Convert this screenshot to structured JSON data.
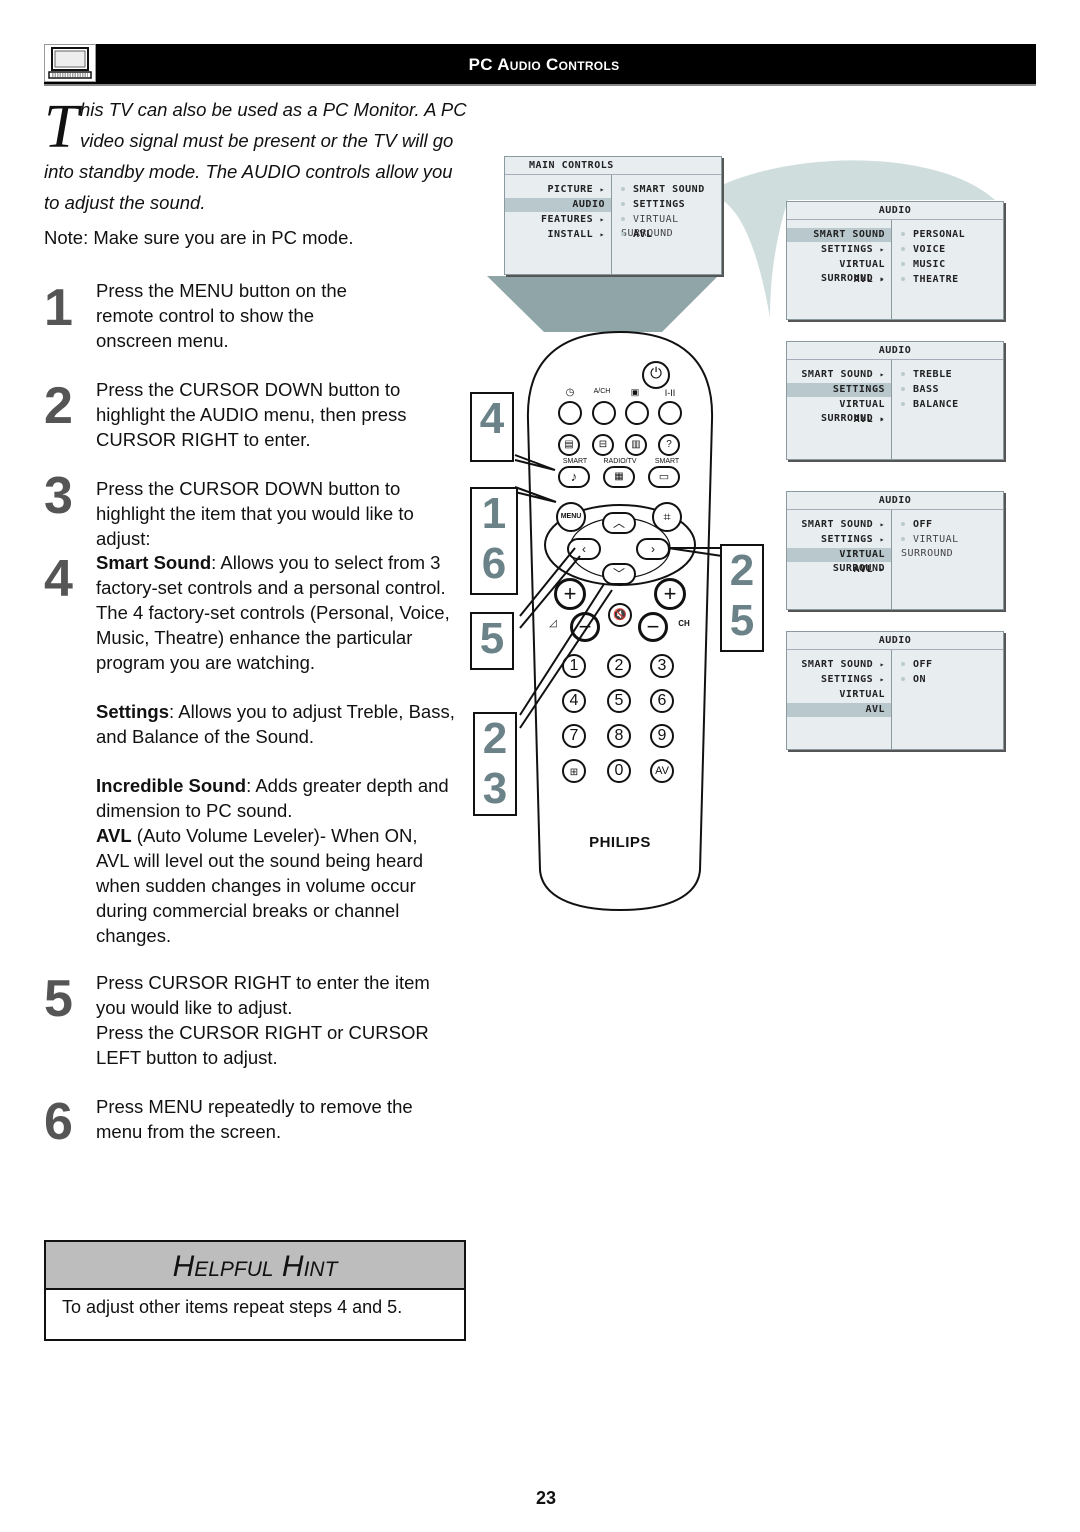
{
  "header": {
    "title": "PC Audio Controls",
    "icon": "pc-monitor-icon"
  },
  "intro": {
    "dropcap": "T",
    "line1": "his TV can also be used as a PC Monitor. A PC",
    "line2": "video signal must be present or the TV will go",
    "line3": "into standby mode. The AUDIO controls allow you",
    "line4": "to adjust the sound.",
    "note": "Note: Make sure you are in PC mode."
  },
  "steps": [
    {
      "num": "1",
      "lines": [
        "Press the MENU button on the",
        "remote control to show the",
        "onscreen menu."
      ]
    },
    {
      "num": "2",
      "lines": [
        "Press the CURSOR DOWN button to",
        "highlight the AUDIO menu, then press",
        "CURSOR RIGHT to enter."
      ]
    },
    {
      "num": "3",
      "lines": [
        "Press the CURSOR DOWN  button to",
        "highlight the item that you  would like to",
        "adjust:"
      ]
    },
    {
      "num": "4",
      "smart_sound_term": "Smart Sound",
      "smart_sound_lines": [
        ": Allows you to select from 3",
        "factory-set controls and a personal control.",
        "The 4 factory-set controls (Personal, Voice,",
        "Music, Theatre) enhance the particular",
        "program you are watching."
      ],
      "settings_term": "Settings",
      "settings_lines": [
        ": Allows you to adjust Treble, Bass,",
        "and Balance of the Sound."
      ],
      "incredible_term": "Incredible Sound",
      "incredible_lines": [
        ": Adds greater depth and",
        "dimension to PC sound."
      ],
      "avl_term": "AVL",
      "avl_lines": [
        " (Auto Volume Leveler)- When ON,",
        "AVL will level out the sound being heard",
        "when sudden changes in volume occur",
        "during commercial breaks or channel",
        "changes."
      ]
    },
    {
      "num": "5",
      "lines": [
        "Press CURSOR RIGHT to enter the item",
        "you would like to adjust.",
        "Press the CURSOR RIGHT or CURSOR",
        "LEFT button to adjust."
      ]
    },
    {
      "num": "6",
      "lines": [
        "Press MENU repeatedly to remove the",
        "menu from the screen."
      ]
    }
  ],
  "hint": {
    "title": "Helpful Hint",
    "body": "To adjust other items repeat steps 4 and 5."
  },
  "page_number": "23",
  "osd_menus": [
    {
      "title": "MAIN CONTROLS",
      "left": [
        {
          "label": "PICTURE",
          "arrow": "▸",
          "selected": false
        },
        {
          "label": "AUDIO",
          "arrow": "",
          "selected": true
        },
        {
          "label": "FEATURES",
          "arrow": "▸",
          "selected": false
        },
        {
          "label": "INSTALL",
          "arrow": "▸",
          "selected": false
        }
      ],
      "right": [
        {
          "label": "SMART SOUND",
          "dim": false
        },
        {
          "label": "SETTINGS",
          "dim": false
        },
        {
          "label": "VIRTUAL SURROUND",
          "dim": true
        },
        {
          "label": "AVL",
          "dim": false
        }
      ]
    },
    {
      "title": "AUDIO",
      "left": [
        {
          "label": "SMART SOUND",
          "arrow": "",
          "selected": true
        },
        {
          "label": "SETTINGS",
          "arrow": "▸",
          "selected": false
        },
        {
          "label": "VIRTUAL SURROUND",
          "arrow": "▸",
          "selected": false
        },
        {
          "label": "AVL",
          "arrow": "▸",
          "selected": false
        }
      ],
      "right": [
        {
          "label": "PERSONAL",
          "dim": false
        },
        {
          "label": "VOICE",
          "dim": false
        },
        {
          "label": "MUSIC",
          "dim": false
        },
        {
          "label": "THEATRE",
          "dim": false
        }
      ]
    },
    {
      "title": "AUDIO",
      "left": [
        {
          "label": "SMART SOUND",
          "arrow": "▸",
          "selected": false
        },
        {
          "label": "SETTINGS",
          "arrow": "",
          "selected": true
        },
        {
          "label": "VIRTUAL SURROUND",
          "arrow": "▸",
          "selected": false
        },
        {
          "label": "AVL",
          "arrow": "▸",
          "selected": false
        }
      ],
      "right": [
        {
          "label": "TREBLE",
          "dim": false
        },
        {
          "label": "BASS",
          "dim": false
        },
        {
          "label": "BALANCE",
          "dim": false
        }
      ]
    },
    {
      "title": "AUDIO",
      "left": [
        {
          "label": "SMART SOUND",
          "arrow": "▸",
          "selected": false
        },
        {
          "label": "SETTINGS",
          "arrow": "▸",
          "selected": false
        },
        {
          "label": "VIRTUAL SURROUND",
          "arrow": "",
          "selected": true
        },
        {
          "label": "AVL",
          "arrow": "▸",
          "selected": false
        }
      ],
      "right": [
        {
          "label": "OFF",
          "dim": false
        },
        {
          "label": "VIRTUAL SURROUND",
          "dim": true
        }
      ]
    },
    {
      "title": "AUDIO",
      "left": [
        {
          "label": "SMART SOUND",
          "arrow": "▸",
          "selected": false
        },
        {
          "label": "SETTINGS",
          "arrow": "▸",
          "selected": false
        },
        {
          "label": "VIRTUAL SURROUND",
          "arrow": "▸",
          "selected": false
        },
        {
          "label": "AVL",
          "arrow": "",
          "selected": true
        }
      ],
      "right": [
        {
          "label": "OFF",
          "dim": false
        },
        {
          "label": "ON",
          "dim": false
        }
      ]
    }
  ],
  "callouts": {
    "left": [
      "4",
      "1\n6",
      "5",
      "2\n3"
    ],
    "right": "2\n5"
  },
  "remote": {
    "brand": "PHILIPS",
    "labels": {
      "ach": "A/CH",
      "i_ii": "I-II",
      "smart1": "SMART",
      "radio_tv": "RADIO/TV",
      "smart2": "SMART",
      "menu": "MENU",
      "ch": "CH"
    },
    "digits": [
      "1",
      "2",
      "3",
      "4",
      "5",
      "6",
      "7",
      "8",
      "9",
      "",
      "0",
      "AV"
    ]
  },
  "colors": {
    "callout_number": "#6a8288",
    "osd_bg": "#e8edf0",
    "osd_highlight": "#b8c8cc",
    "beam": "#8fa5a8",
    "hint_header": "#bdbdbd"
  }
}
